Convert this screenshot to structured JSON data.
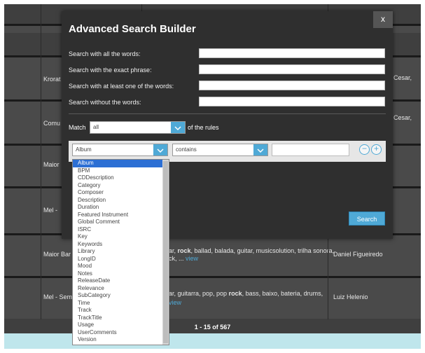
{
  "modal": {
    "title": "Advanced Search Builder",
    "close_label": "x",
    "fields": [
      {
        "label": "Search with all the words:",
        "value": ""
      },
      {
        "label": "Search with the exact phrase:",
        "value": ""
      },
      {
        "label": "Search with at least one of the words:",
        "value": ""
      },
      {
        "label": "Search without the words:",
        "value": ""
      }
    ],
    "match": {
      "label": "Match",
      "value": "all",
      "suffix": "of the rules"
    },
    "rule": {
      "field": "Album",
      "operator": "contains",
      "value": ""
    },
    "search_label": "Search"
  },
  "dropdown": {
    "selected": "Album",
    "options": [
      "Album",
      "BPM",
      "CDDescription",
      "Category",
      "Composer",
      "Description",
      "Duration",
      "Featured Instrument",
      "Global Comment",
      "ISRC",
      "Key",
      "Keywords",
      "Library",
      "LongID",
      "Mood",
      "Notes",
      "ReleaseDate",
      "Relevance",
      "SubCategory",
      "Time",
      "Track",
      "TrackTitle",
      "Usage",
      "UserComments",
      "Version"
    ]
  },
  "background": {
    "rows": [
      {
        "name": "Krorat",
        "right": "Cesar,"
      },
      {
        "name": "Comu",
        "right": "Cesar,"
      },
      {
        "name": "Maior",
        "right": ""
      },
      {
        "name": "Mel -",
        "right": ""
      },
      {
        "name": "Maior Bar",
        "keywords_a": "ar, ",
        "keywords_b": "rock",
        "keywords_c": ", ballad, balada, guitar, musicsolution, trilha sonora,",
        "keywords_d": "ck, ...",
        "view": "view",
        "artist": "Daniel Figueiredo"
      },
      {
        "name": "Mel - Sem",
        "keywords_a": "ar, guitarra, pop, pop ",
        "keywords_b": "rock",
        "keywords_c": ", bass, baixo, bateria, drums,",
        "keywords_d": "",
        "view": "view",
        "artist": "Luiz Helenio"
      }
    ],
    "pager": "1 - 15 of 567"
  },
  "colors": {
    "accent": "#4fa9d6",
    "selected": "#2c6fd4",
    "modal_bg": "#2f2f2f"
  }
}
